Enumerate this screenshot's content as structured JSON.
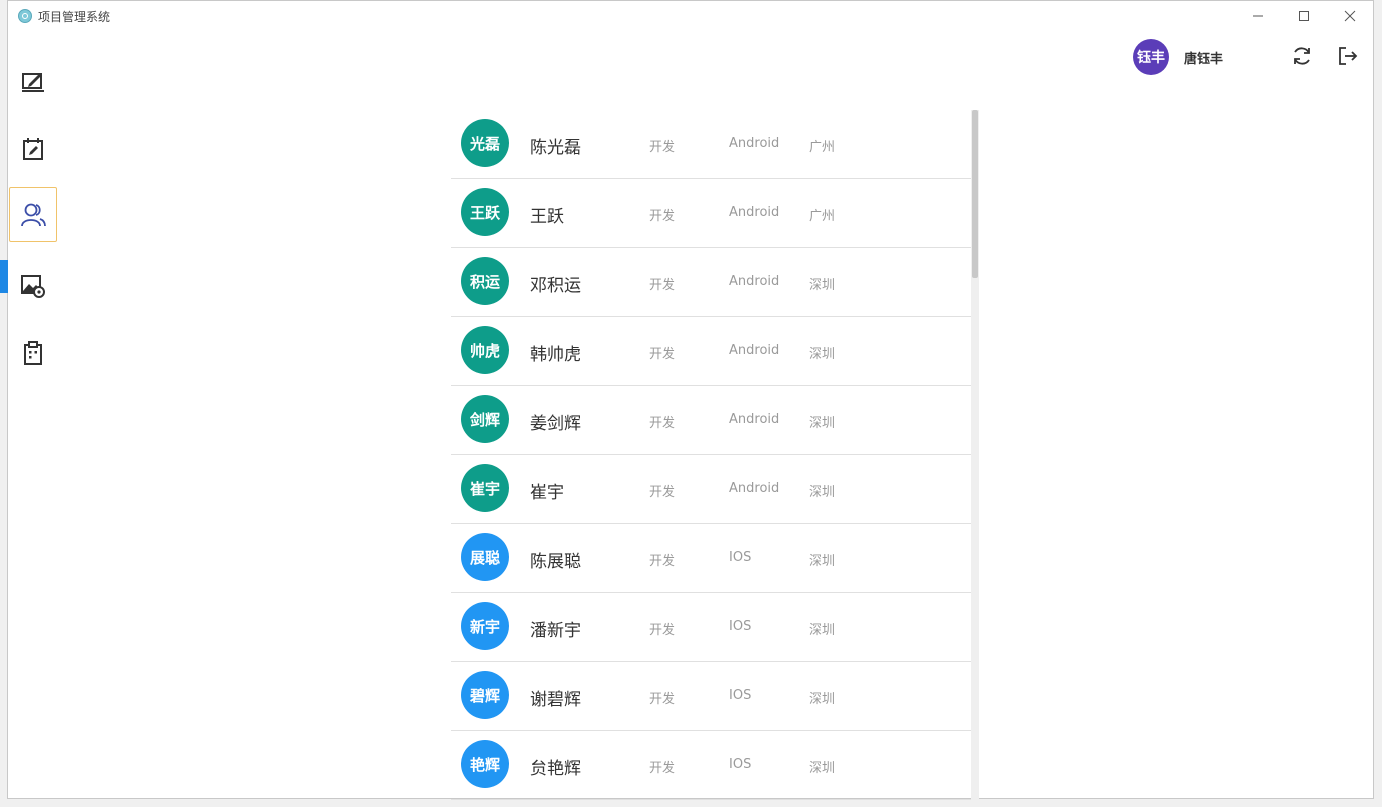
{
  "window": {
    "title": "项目管理系统"
  },
  "colors": {
    "android_avatar": "#0e9d8a",
    "ios_avatar": "#2196f3",
    "user_avatar": "#5b3db8",
    "active_marker": "#1e88e5",
    "active_border": "#f0c36a"
  },
  "sidebar": {
    "items": [
      {
        "icon": "edit-note-icon"
      },
      {
        "icon": "calendar-edit-icon"
      },
      {
        "icon": "contacts-icon",
        "active": true
      },
      {
        "icon": "image-settings-icon"
      },
      {
        "icon": "clipboard-icon"
      }
    ]
  },
  "header": {
    "user": {
      "avatar_text": "钰丰",
      "name": "唐钰丰"
    },
    "refresh_icon": "refresh-icon",
    "logout_icon": "logout-icon"
  },
  "members": [
    {
      "avatar": "光磊",
      "name": "陈光磊",
      "dept": "开发",
      "platform": "Android",
      "city": "广州"
    },
    {
      "avatar": "王跃",
      "name": "王跃",
      "dept": "开发",
      "platform": "Android",
      "city": "广州"
    },
    {
      "avatar": "积运",
      "name": "邓积运",
      "dept": "开发",
      "platform": "Android",
      "city": "深圳"
    },
    {
      "avatar": "帅虎",
      "name": "韩帅虎",
      "dept": "开发",
      "platform": "Android",
      "city": "深圳"
    },
    {
      "avatar": "剑辉",
      "name": "姜剑辉",
      "dept": "开发",
      "platform": "Android",
      "city": "深圳"
    },
    {
      "avatar": "崔宇",
      "name": "崔宇",
      "dept": "开发",
      "platform": "Android",
      "city": "深圳"
    },
    {
      "avatar": "展聪",
      "name": "陈展聪",
      "dept": "开发",
      "platform": "IOS",
      "city": "深圳"
    },
    {
      "avatar": "新宇",
      "name": "潘新宇",
      "dept": "开发",
      "platform": "IOS",
      "city": "深圳"
    },
    {
      "avatar": "碧辉",
      "name": "谢碧辉",
      "dept": "开发",
      "platform": "IOS",
      "city": "深圳"
    },
    {
      "avatar": "艳辉",
      "name": "贠艳辉",
      "dept": "开发",
      "platform": "IOS",
      "city": "深圳"
    }
  ]
}
